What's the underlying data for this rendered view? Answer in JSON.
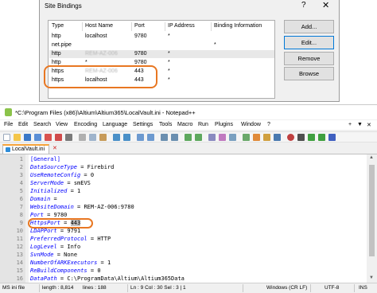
{
  "dialog": {
    "title": "Site Bindings",
    "help": "?",
    "close": "✕",
    "columns": [
      "Type",
      "Host Name",
      "Port",
      "IP Address",
      "Binding Information"
    ],
    "rows": [
      {
        "type": "http",
        "host": "localhost",
        "port": "9780",
        "ip": "*",
        "info": "",
        "host_blurred": false,
        "shaded": false
      },
      {
        "type": "net.pipe",
        "host": "",
        "port": "",
        "ip": "",
        "info": "*",
        "host_blurred": false,
        "shaded": false
      },
      {
        "type": "http",
        "host": "REM-AZ-006",
        "port": "9780",
        "ip": "*",
        "info": "",
        "host_blurred": true,
        "shaded": true
      },
      {
        "type": "http",
        "host": "*",
        "port": "9780",
        "ip": "*",
        "info": "",
        "host_blurred": false,
        "shaded": false
      },
      {
        "type": "https",
        "host": "REM-AZ-006",
        "port": "443",
        "ip": "*",
        "info": "",
        "host_blurred": true,
        "shaded": false
      },
      {
        "type": "https",
        "host": "localhost",
        "port": "443",
        "ip": "*",
        "info": "",
        "host_blurred": false,
        "shaded": false
      }
    ],
    "buttons": {
      "add": "Add...",
      "edit": "Edit...",
      "remove": "Remove",
      "browse": "Browse"
    }
  },
  "notepad": {
    "title": "*C:\\Program Files (x86)\\Altium\\Altium365\\LocalVault.ini - Notepad++",
    "menu": [
      "File",
      "Edit",
      "Search",
      "View",
      "Encoding",
      "Language",
      "Settings",
      "Tools",
      "Macro",
      "Run",
      "Plugins",
      "Window",
      "?"
    ],
    "menu_right": [
      "+",
      "▼",
      "✕"
    ],
    "tab": {
      "label": "LocalVault.ini",
      "close": "✕"
    },
    "lines": [
      {
        "n": "1",
        "key": "[General]",
        "sep": "",
        "val": "",
        "section": true
      },
      {
        "n": "2",
        "key": "DataSourceType",
        "sep": " = ",
        "val": "Firebird"
      },
      {
        "n": "3",
        "key": "UseRemoteConfig",
        "sep": " = ",
        "val": "0"
      },
      {
        "n": "4",
        "key": "ServerMode",
        "sep": " = ",
        "val": "smEVS"
      },
      {
        "n": "5",
        "key": "Initialized",
        "sep": " = ",
        "val": "1"
      },
      {
        "n": "6",
        "key": "Domain",
        "sep": " =",
        "val": ""
      },
      {
        "n": "7",
        "key": "WebsiteDomain",
        "sep": " = ",
        "val": "REM-AZ-006:9780"
      },
      {
        "n": "8",
        "key": "Port",
        "sep": " = ",
        "val": "9780"
      },
      {
        "n": "9",
        "key": "HttpsPort",
        "sep": " = ",
        "val": "443",
        "selected": true
      },
      {
        "n": "10",
        "key": "LDAPPort",
        "sep": " = ",
        "val": "9791"
      },
      {
        "n": "11",
        "key": "PreferredProtocol",
        "sep": " = ",
        "val": "HTTP"
      },
      {
        "n": "12",
        "key": "LogLevel",
        "sep": " = ",
        "val": "Info"
      },
      {
        "n": "13",
        "key": "SvnMode",
        "sep": " = ",
        "val": "None"
      },
      {
        "n": "14",
        "key": "NumberOfARKExecutors",
        "sep": " = ",
        "val": "1"
      },
      {
        "n": "15",
        "key": "ReBuildComponents",
        "sep": " = ",
        "val": "0"
      },
      {
        "n": "16",
        "key": "DataPath",
        "sep": " = ",
        "val": "C:\\ProgramData\\Altium\\Altium365Data"
      }
    ],
    "status": {
      "filetype": "MS ini file",
      "length": "length : 8,814",
      "lines": "lines : 188",
      "position": "Ln : 9    Col : 30    Sel : 3 | 1",
      "eol": "Windows (CR LF)",
      "encoding": "UTF-8",
      "mode": "INS"
    }
  },
  "colors": {
    "highlight": "#e87722",
    "keyword": "#0000ff",
    "tab_accent": "#f7a43b"
  }
}
